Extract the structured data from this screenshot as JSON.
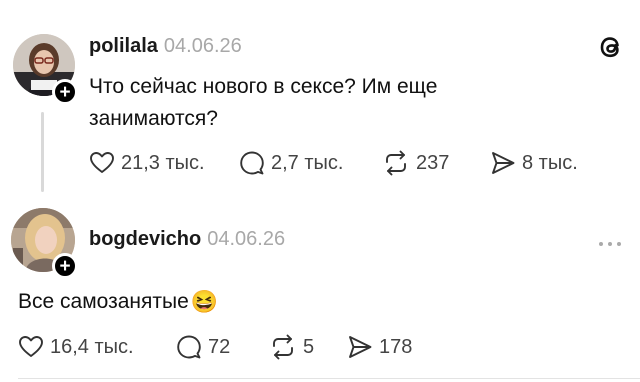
{
  "app": {
    "logo_icon": "threads-logo-icon"
  },
  "posts": [
    {
      "author": "polilala",
      "date": "04.06.26",
      "text": "Что сейчас нового в сексе? Им еще занимаются?",
      "likes": "21,3 тыс.",
      "replies": "2,7 тыс.",
      "reposts": "237",
      "shares": "8 тыс."
    },
    {
      "author": "bogdevicho",
      "date": "04.06.26",
      "text": "Все самозанятые",
      "emoji": "😆",
      "likes": "16,4 тыс.",
      "replies": "72",
      "reposts": "5",
      "shares": "178"
    }
  ],
  "icons": {
    "like": "heart-icon",
    "reply": "comment-bubble-icon",
    "repost": "repost-arrows-icon",
    "share": "send-arrow-icon",
    "more": "more-dots-icon",
    "follow": "plus-icon"
  }
}
